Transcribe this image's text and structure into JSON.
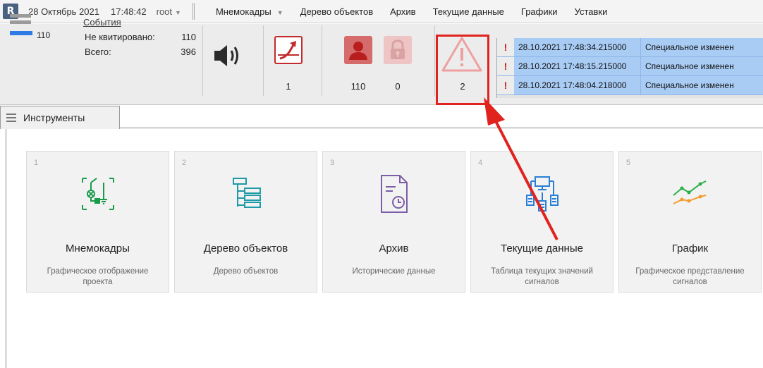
{
  "topbar": {
    "logo_glyph": "R",
    "date": "28 Октябрь 2021",
    "time": "17:48:42",
    "user": "root",
    "caret": "▼",
    "menu": [
      {
        "label": "Мнемокадры",
        "has_caret": true
      },
      {
        "label": "Дерево объектов"
      },
      {
        "label": "Архив"
      },
      {
        "label": "Текущие данные"
      },
      {
        "label": "Графики"
      },
      {
        "label": "Уставки"
      }
    ]
  },
  "status": {
    "level_count": "110",
    "events": {
      "title": "События",
      "unack_label": "Не квитировано:",
      "unack_value": "110",
      "total_label": "Всего:",
      "total_value": "396"
    },
    "indicators": {
      "trend": "1",
      "user": "110",
      "lock": "0",
      "alarm": "2"
    },
    "event_rows": [
      {
        "mark": "!",
        "timestamp": "28.10.2021 17:48:34.215000",
        "message": "Специальное изменен"
      },
      {
        "mark": "!",
        "timestamp": "28.10.2021 17:48:15.215000",
        "message": "Специальное изменен"
      },
      {
        "mark": "!",
        "timestamp": "28.10.2021 17:48:04.218000",
        "message": "Специальное изменен"
      }
    ]
  },
  "tools_tab": {
    "label": "Инструменты"
  },
  "cards": [
    {
      "index": "1",
      "title": "Мнемокадры",
      "desc": "Графическое отображение проекта",
      "icon": "mnemo-scheme-icon"
    },
    {
      "index": "2",
      "title": "Дерево объектов",
      "desc": "Дерево объектов",
      "icon": "object-tree-icon"
    },
    {
      "index": "3",
      "title": "Архив",
      "desc": "Исторические данные",
      "icon": "archive-document-clock-icon"
    },
    {
      "index": "4",
      "title": "Текущие данные",
      "desc": "Таблица текущих значений сигналов",
      "icon": "network-data-icon"
    },
    {
      "index": "5",
      "title": "График",
      "desc": "Графическое представление сигналов",
      "icon": "line-chart-icon"
    }
  ],
  "colors": {
    "accent_blue": "#2f7be6",
    "alarm_red": "#e0231e",
    "event_row_blue": "#a9ccf5",
    "mnemo_green": "#1a9b4a",
    "tree_teal": "#1e9aa8",
    "archive_purple": "#7b5ea7",
    "data_blue": "#2a7fd6",
    "chart_green": "#2bae4a",
    "chart_orange": "#f29b2e"
  }
}
